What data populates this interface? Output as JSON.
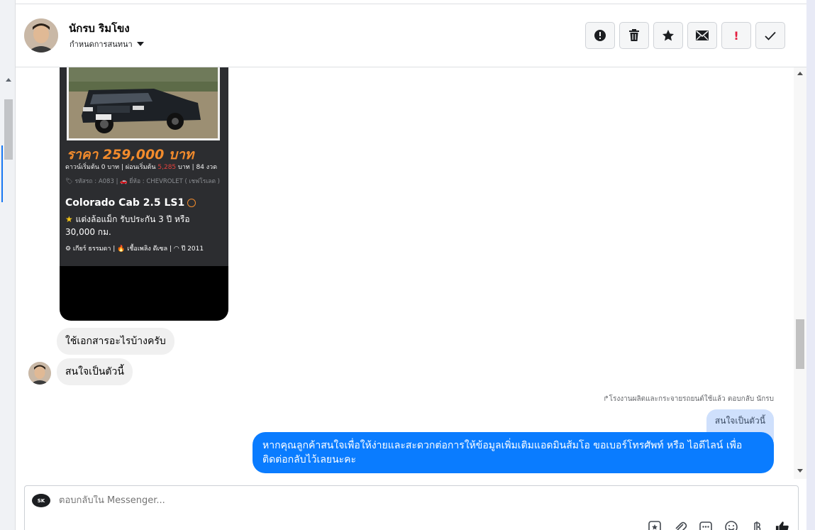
{
  "header": {
    "name": "นักรบ ริมโขง",
    "assign_label": "กำหนดการสนทนา"
  },
  "toolbar": {
    "buttons": [
      {
        "icon": "alert-circle-icon"
      },
      {
        "icon": "trash-icon"
      },
      {
        "icon": "star-icon"
      },
      {
        "icon": "envelope-icon"
      },
      {
        "icon": "exclamation-icon",
        "color": "#e41e3f",
        "text": "!"
      },
      {
        "icon": "checkmark-icon"
      }
    ]
  },
  "card": {
    "price": "ราคา 259,000 บาท",
    "terms_pre": "ดาวน์เริ่มต้น 0 บาท | ผ่อนเริ่มต้น ",
    "terms_red": "5,285",
    "terms_post": " บาท | 84 งวด",
    "meta": "🏷 รหัสรถ : A083 | 🚗 ยี่ห้อ : CHEVROLET ( เชฟโรเลต )",
    "model": "Colorado Cab 2.5 LS1",
    "feature": "แต่งล้อแม็ก รับประกัน 3 ปี หรือ 30,000 กม.",
    "specs": "⚙ เกียร์ ธรรมดา  |  🔥 เชื้อเพลิง ดีเซล  |  ◠ ปี 2011"
  },
  "messages": {
    "in_1": "ใช้เอกสารอะไรบ้างครับ",
    "in_2": "สนใจเป็นตัวนี้",
    "reply_note": "↱โรงงานผลิตและกระจายรถยนต์ใช้แล้ว ตอบกลับ นักรบ",
    "quoted": "สนใจเป็นตัวนี้",
    "out_1": "หากคุณลูกค้าสนใจเพื่อให้ง่ายและสะดวกต่อการให้ข้อมูลเพิ่มเติมแอดมินส้มโอ ขอเบอร์โทรศัพท์ หรือ ไอดีไลน์ เพื่อติดต่อกลับไว้เลยนะคะ"
  },
  "composer": {
    "placeholder": "ตอบกลับใน Messenger...",
    "page_logo_text": "SK",
    "icons": [
      "saved-reply-icon",
      "attachment-icon",
      "more-chat-icon",
      "emoji-icon",
      "baht-payment-icon",
      "thumbs-up-icon"
    ]
  },
  "colors": {
    "outgoing_bubble": "#0a7cff",
    "incoming_bubble": "#f0f0f0",
    "quoted_bubble": "#cfe0fc",
    "price": "#f28b2c"
  }
}
